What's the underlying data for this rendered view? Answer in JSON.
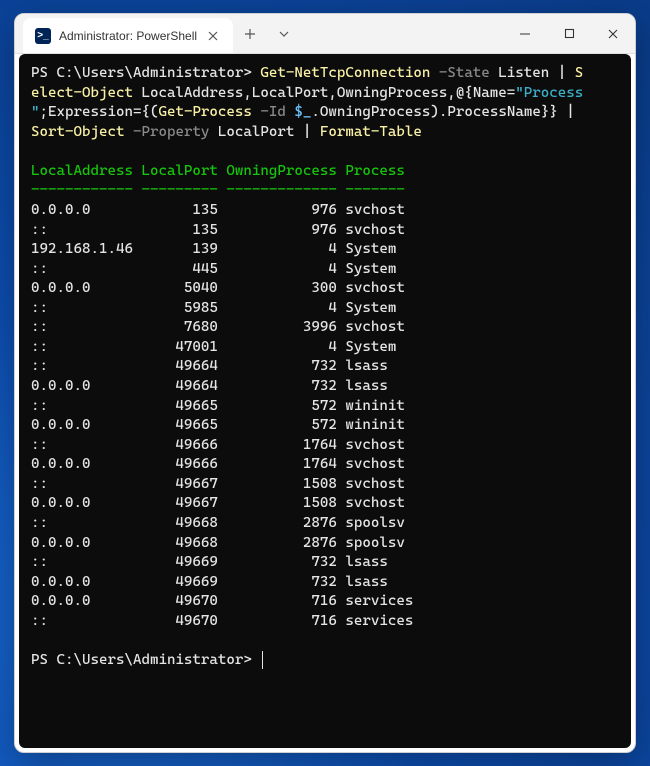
{
  "tab": {
    "title": "Administrator: PowerShell",
    "icon_glyph": ">_"
  },
  "prompt1": "PS C:\\Users\\Administrator> ",
  "prompt2": "PS C:\\Users\\Administrator> ",
  "command": {
    "cmdlet1": "Get-NetTcpConnection",
    "param_state": " -State",
    "state_value": " Listen",
    "pipe1": " |",
    "select_intro_start": " S",
    "select_cmd": "elect-Object",
    "select_props": " LocalAddress,LocalPort,OwningProcess,",
    "at_open": "@{",
    "name_key": "Name=",
    "name_val": "\"Process\n\"",
    "semi": ";",
    "expr_key": "Expression={",
    "getproc_open": "(",
    "getproc": "Get-Process",
    "getproc_id": " -Id",
    "dollar_under": " $_",
    "dot_owning": ".",
    "owning_prop": "OwningProcess",
    "close_paren": ")",
    "dot_procname": ".",
    "procname": "ProcessName}}",
    "pipe2": " |",
    "sort_nl": " ",
    "sort_cmd": "Sort-Object",
    "sort_prop_flag": " -Property",
    "sort_prop": " LocalPort",
    "pipe3": " |",
    "format": " Format-Table"
  },
  "table": {
    "headers": {
      "col0": "LocalAddress",
      "col1": "LocalPort",
      "col2": "OwningProcess",
      "col3": "Process"
    },
    "rows": [
      {
        "addr": "0.0.0.0",
        "port": "135",
        "pid": "976",
        "proc": "svchost"
      },
      {
        "addr": "::",
        "port": "135",
        "pid": "976",
        "proc": "svchost"
      },
      {
        "addr": "192.168.1.46",
        "port": "139",
        "pid": "4",
        "proc": "System"
      },
      {
        "addr": "::",
        "port": "445",
        "pid": "4",
        "proc": "System"
      },
      {
        "addr": "0.0.0.0",
        "port": "5040",
        "pid": "300",
        "proc": "svchost"
      },
      {
        "addr": "::",
        "port": "5985",
        "pid": "4",
        "proc": "System"
      },
      {
        "addr": "::",
        "port": "7680",
        "pid": "3996",
        "proc": "svchost"
      },
      {
        "addr": "::",
        "port": "47001",
        "pid": "4",
        "proc": "System"
      },
      {
        "addr": "::",
        "port": "49664",
        "pid": "732",
        "proc": "lsass"
      },
      {
        "addr": "0.0.0.0",
        "port": "49664",
        "pid": "732",
        "proc": "lsass"
      },
      {
        "addr": "::",
        "port": "49665",
        "pid": "572",
        "proc": "wininit"
      },
      {
        "addr": "0.0.0.0",
        "port": "49665",
        "pid": "572",
        "proc": "wininit"
      },
      {
        "addr": "::",
        "port": "49666",
        "pid": "1764",
        "proc": "svchost"
      },
      {
        "addr": "0.0.0.0",
        "port": "49666",
        "pid": "1764",
        "proc": "svchost"
      },
      {
        "addr": "::",
        "port": "49667",
        "pid": "1508",
        "proc": "svchost"
      },
      {
        "addr": "0.0.0.0",
        "port": "49667",
        "pid": "1508",
        "proc": "svchost"
      },
      {
        "addr": "::",
        "port": "49668",
        "pid": "2876",
        "proc": "spoolsv"
      },
      {
        "addr": "0.0.0.0",
        "port": "49668",
        "pid": "2876",
        "proc": "spoolsv"
      },
      {
        "addr": "::",
        "port": "49669",
        "pid": "732",
        "proc": "lsass"
      },
      {
        "addr": "0.0.0.0",
        "port": "49669",
        "pid": "732",
        "proc": "lsass"
      },
      {
        "addr": "0.0.0.0",
        "port": "49670",
        "pid": "716",
        "proc": "services"
      },
      {
        "addr": "::",
        "port": "49670",
        "pid": "716",
        "proc": "services"
      }
    ],
    "widths": {
      "addr": 12,
      "port": 9,
      "pid": 13
    }
  }
}
